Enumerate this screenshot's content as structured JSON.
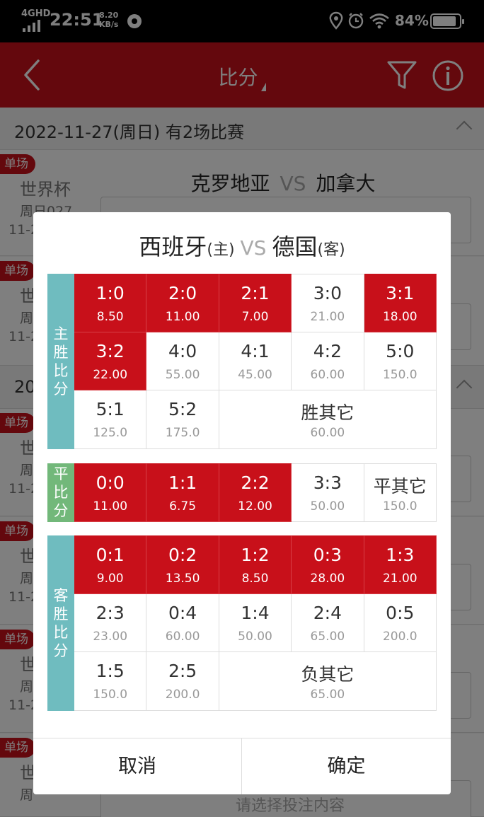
{
  "status_bar": {
    "network": "4GHD",
    "time": "22:51",
    "speed_value": "8.20",
    "speed_unit": "KB/s",
    "battery": "84%"
  },
  "header": {
    "title": "比分"
  },
  "background": {
    "date_row_1": "2022-11-27(周日) 有2场比赛",
    "date_row_2": "20",
    "matches": [
      {
        "tag": "单场",
        "league": "世界杯",
        "week": "周日027",
        "time": "11-2",
        "home": "克罗地亚",
        "vs": "VS",
        "away": "加拿大"
      },
      {
        "tag": "单场",
        "league": "世",
        "week": "周",
        "time": "11-2"
      },
      {
        "tag": "单场",
        "league": "世",
        "week": "周",
        "time": "11-2"
      },
      {
        "tag": "单场",
        "league": "世",
        "week": "周",
        "time": "11-2"
      },
      {
        "tag": "单场",
        "league": "世",
        "week": "周",
        "time": "11-2"
      },
      {
        "tag": "单场",
        "league": "世",
        "week": "周",
        "time": "",
        "hint": "请选择投注内容"
      }
    ]
  },
  "dialog": {
    "home": "西班牙",
    "home_tag": "(主)",
    "vs": "VS",
    "away": "德国",
    "away_tag": "(客)",
    "sections": {
      "home_win": {
        "label": [
          "主",
          "胜",
          "比",
          "分"
        ],
        "cells": [
          {
            "score": "1:0",
            "odds": "8.50",
            "selected": true
          },
          {
            "score": "2:0",
            "odds": "11.00",
            "selected": true
          },
          {
            "score": "2:1",
            "odds": "7.00",
            "selected": true
          },
          {
            "score": "3:0",
            "odds": "21.00",
            "selected": false
          },
          {
            "score": "3:1",
            "odds": "18.00",
            "selected": true
          },
          {
            "score": "3:2",
            "odds": "22.00",
            "selected": true
          },
          {
            "score": "4:0",
            "odds": "55.00",
            "selected": false
          },
          {
            "score": "4:1",
            "odds": "45.00",
            "selected": false
          },
          {
            "score": "4:2",
            "odds": "60.00",
            "selected": false
          },
          {
            "score": "5:0",
            "odds": "150.0",
            "selected": false
          },
          {
            "score": "5:1",
            "odds": "125.0",
            "selected": false
          },
          {
            "score": "5:2",
            "odds": "175.0",
            "selected": false
          },
          {
            "score": "胜其它",
            "odds": "60.00",
            "selected": false
          }
        ]
      },
      "draw": {
        "label": [
          "平",
          "比",
          "分"
        ],
        "cells": [
          {
            "score": "0:0",
            "odds": "11.00",
            "selected": true
          },
          {
            "score": "1:1",
            "odds": "6.75",
            "selected": true
          },
          {
            "score": "2:2",
            "odds": "12.00",
            "selected": true
          },
          {
            "score": "3:3",
            "odds": "50.00",
            "selected": false
          },
          {
            "score": "平其它",
            "odds": "150.0",
            "selected": false
          }
        ]
      },
      "away_win": {
        "label": [
          "客",
          "胜",
          "比",
          "分"
        ],
        "cells": [
          {
            "score": "0:1",
            "odds": "9.00",
            "selected": true
          },
          {
            "score": "0:2",
            "odds": "13.50",
            "selected": true
          },
          {
            "score": "1:2",
            "odds": "8.50",
            "selected": true
          },
          {
            "score": "0:3",
            "odds": "28.00",
            "selected": true
          },
          {
            "score": "1:3",
            "odds": "21.00",
            "selected": true
          },
          {
            "score": "2:3",
            "odds": "23.00",
            "selected": false
          },
          {
            "score": "0:4",
            "odds": "60.00",
            "selected": false
          },
          {
            "score": "1:4",
            "odds": "50.00",
            "selected": false
          },
          {
            "score": "2:4",
            "odds": "65.00",
            "selected": false
          },
          {
            "score": "0:5",
            "odds": "200.0",
            "selected": false
          },
          {
            "score": "1:5",
            "odds": "150.0",
            "selected": false
          },
          {
            "score": "2:5",
            "odds": "200.0",
            "selected": false
          },
          {
            "score": "负其它",
            "odds": "65.00",
            "selected": false
          }
        ]
      }
    },
    "cancel_label": "取消",
    "confirm_label": "确定"
  },
  "colors": {
    "brand_red": "#c8101a",
    "side_teal": "#6fbcbf",
    "side_green": "#72b87a"
  }
}
